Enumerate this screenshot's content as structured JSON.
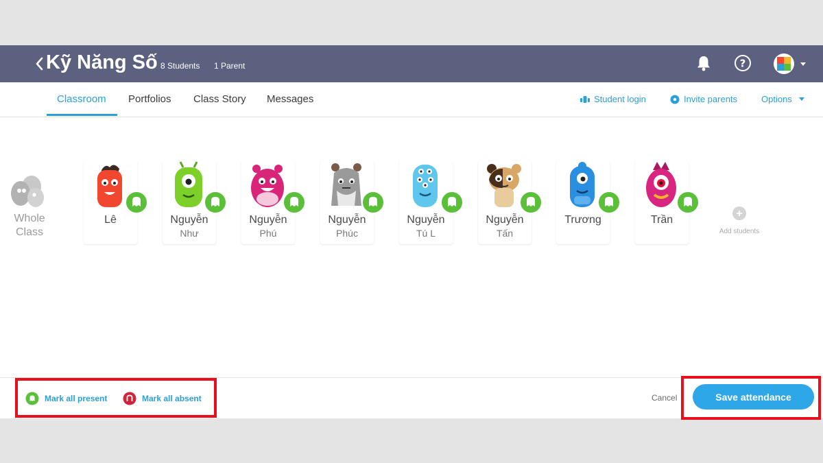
{
  "header": {
    "class_name": "Kỹ Năng Số",
    "students_count": "8 Students",
    "parents_count": "1 Parent",
    "bg_color": "#5c6180",
    "icons": [
      "back-chevron-icon",
      "bell-icon",
      "help-icon",
      "avatar-icon",
      "caret-down-icon"
    ]
  },
  "tabs": [
    {
      "label": "Classroom",
      "active": true
    },
    {
      "label": "Portfolios",
      "active": false
    },
    {
      "label": "Class Story",
      "active": false
    },
    {
      "label": "Messages",
      "active": false
    }
  ],
  "right_links": {
    "student_login": "Student login",
    "invite_parents": "Invite parents",
    "options": "Options"
  },
  "whole_class": {
    "line1": "Whole",
    "line2": "Class"
  },
  "students": [
    {
      "line1": "Lê",
      "line2": "",
      "monster_color": "#f0472e",
      "status": "present"
    },
    {
      "line1": "Nguyễn",
      "line2": "Như",
      "monster_color": "#7dcf2a",
      "status": "present"
    },
    {
      "line1": "Nguyễn",
      "line2": "Phú",
      "monster_color": "#d8257a",
      "status": "present"
    },
    {
      "line1": "Nguyễn",
      "line2": "Phúc",
      "monster_color": "#9a9a9a",
      "status": "present"
    },
    {
      "line1": "Nguyễn",
      "line2": "Tú L",
      "monster_color": "#5fc6ee",
      "status": "present"
    },
    {
      "line1": "Nguyễn",
      "line2": "Tấn",
      "monster_color": "#d9a765",
      "status": "present"
    },
    {
      "line1": "Trương",
      "line2": "",
      "monster_color": "#2b8fe0",
      "status": "present"
    },
    {
      "line1": "Trần",
      "line2": "",
      "monster_color": "#d8257f",
      "status": "present"
    }
  ],
  "add_students_label": "Add students",
  "footer": {
    "mark_all_present": "Mark all present",
    "mark_all_absent": "Mark all absent",
    "cancel": "Cancel",
    "save": "Save attendance"
  },
  "colors": {
    "accent": "#2a9fd8",
    "present_green": "#5bbf3a",
    "absent_red": "#d0233c",
    "highlight_red": "#e8101a"
  }
}
